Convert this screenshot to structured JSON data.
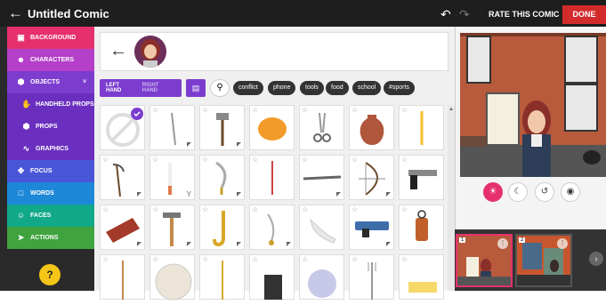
{
  "topbar": {
    "title": "Untitled Comic",
    "rate_label": "RATE THIS COMIC",
    "done_label": "DONE"
  },
  "sidebar": {
    "items": [
      {
        "label": "BACKGROUND",
        "icon": "image-icon",
        "color": "#e6306e"
      },
      {
        "label": "CHARACTERS",
        "icon": "face-icon",
        "color": "#b43fc9"
      },
      {
        "label": "OBJECTS",
        "icon": "hexagon-icon",
        "color": "#7c3dcf"
      },
      {
        "label": "HANDHELD PROPS",
        "icon": "hand-icon",
        "color": "#6a2fbf"
      },
      {
        "label": "PROPS",
        "icon": "hexagon-icon",
        "color": "#6a2fbf"
      },
      {
        "label": "GRAPHICS",
        "icon": "scribble-icon",
        "color": "#6a2fbf"
      },
      {
        "label": "FOCUS",
        "icon": "arrows-icon",
        "color": "#4a56d8"
      },
      {
        "label": "WORDS",
        "icon": "speech-bubble-icon",
        "color": "#1e88d8"
      },
      {
        "label": "FACES",
        "icon": "smiley-icon",
        "color": "#12a88a"
      },
      {
        "label": "ACTIONS",
        "icon": "run-icon",
        "color": "#3fa33f"
      }
    ],
    "help_label": "?"
  },
  "filters": {
    "left_hand": "LEFT HAND",
    "right_hand": "RIGHT HAND",
    "tags": [
      "conflict",
      "phone",
      "tools",
      "food",
      "school",
      "#sports"
    ]
  },
  "grid": {
    "items": [
      "none",
      "sword",
      "mace",
      "orange",
      "scissors",
      "vase",
      "pencil",
      "scythe",
      "cigarette",
      "scimitar",
      "wand",
      "rifle",
      "bow",
      "pistol",
      "book",
      "hammer",
      "saxophone",
      "sabre",
      "high-heel",
      "blaster",
      "lantern",
      "staff",
      "plate",
      "sceptre",
      "suitcase",
      "crystal-ball",
      "fork",
      "butter"
    ]
  },
  "colors": {
    "accent": "#7c3dcf",
    "done": "#d32b2b",
    "mode_active": "#e6306e"
  },
  "thumbs": [
    "1",
    "2"
  ]
}
